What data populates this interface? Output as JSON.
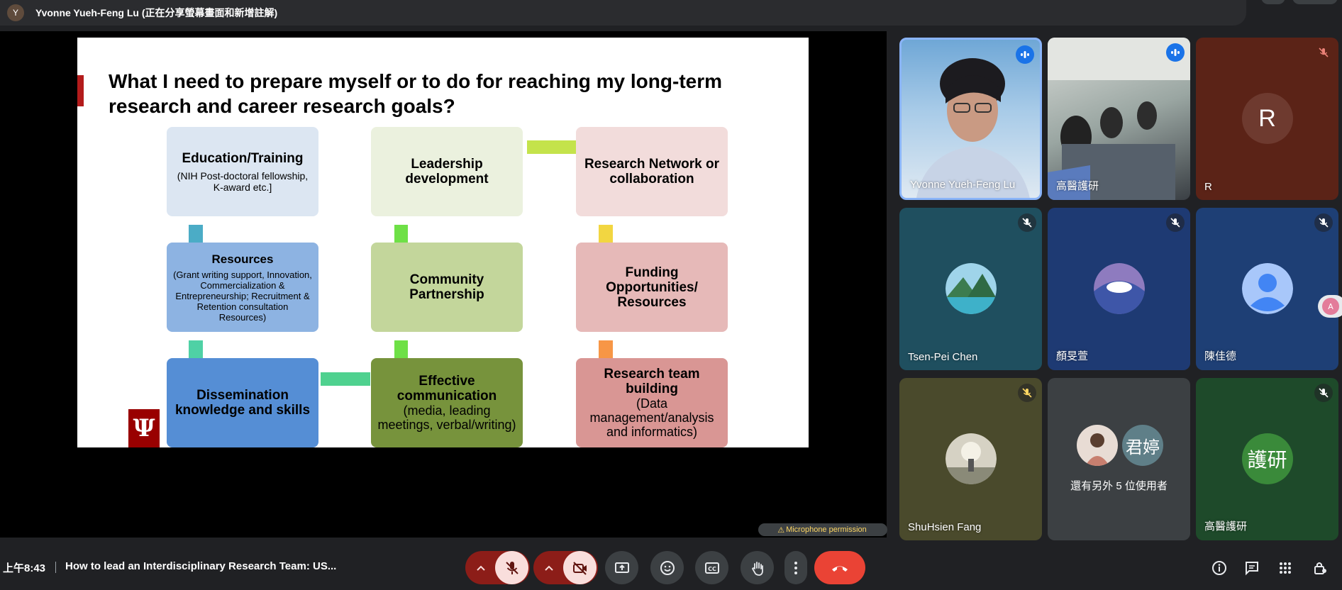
{
  "topbar": {
    "avatar_letter": "Y",
    "presenter_text": "Yvonne Yueh-Feng Lu (正在分享螢幕畫面和新增註解)"
  },
  "slide": {
    "title": "What I need to prepare myself or to do for reaching my long-term research and career research goals?",
    "logo_text": "Ψ",
    "boxes": [
      {
        "title": "Education/Training",
        "sub": "(NIH Post-doctoral fellowship, K-award etc.]",
        "color": "#dce6f2"
      },
      {
        "title": "Leadership development",
        "sub": "",
        "color": "#ebf1de"
      },
      {
        "title": "Research Network or collaboration",
        "sub": "",
        "color": "#f2dcdb"
      },
      {
        "title": "Resources",
        "sub": "(Grant writing support, Innovation, Commercialization & Entrepreneurship; Recruitment & Retention consultation Resources)",
        "color": "#8db3e2"
      },
      {
        "title": "Community Partnership",
        "sub": "",
        "color": "#c3d69b"
      },
      {
        "title": "Funding Opportunities/ Resources",
        "sub": "",
        "color": "#e6b9b8"
      },
      {
        "title": "Dissemination knowledge and skills",
        "sub": "",
        "color": "#558ed5"
      },
      {
        "title": "Effective communication",
        "sub": "(media, leading meetings, verbal/writing)",
        "color": "#77933c"
      },
      {
        "title": "Research team building",
        "sub": "(Data management/analysis and informatics)",
        "color": "#d99694"
      }
    ],
    "connector_colors": {
      "teal": "#4bacc6",
      "mint": "#4fd1a5",
      "green": "#6ee046",
      "lime": "#c4e34b",
      "yellow": "#f2d641",
      "orange": "#f79646",
      "seafoam": "#4fd18f"
    }
  },
  "mic_permission": {
    "icon": "⚠",
    "text": "Microphone permission"
  },
  "participants": [
    {
      "name": "Yvonne Yueh-Feng Lu",
      "type": "video",
      "badge": "speaking-icon"
    },
    {
      "name": "高醫護研",
      "type": "video",
      "badge": "speaking-icon"
    },
    {
      "name": "R",
      "initial": "R",
      "type": "initial",
      "badge": "mic-off-icon"
    },
    {
      "name": "Tsen-Pei Chen",
      "type": "photo",
      "badge": "mic-off-icon"
    },
    {
      "name": "顏旻萱",
      "type": "photo",
      "badge": "mic-off-icon"
    },
    {
      "name": "陳佳德",
      "type": "default-avatar",
      "badge": "mic-off-icon"
    },
    {
      "name": "ShuHsien Fang",
      "type": "photo",
      "badge": "mic-off-icon"
    },
    {
      "name": "",
      "type": "overflow",
      "initial": "君婷",
      "overflow_text": "還有另外 5 位使用者"
    },
    {
      "name": "高醫護研",
      "initial": "護研",
      "type": "initial",
      "badge": "mic-off-icon"
    }
  ],
  "bottombar": {
    "time": "上午8:43",
    "meeting_title": "How to lead an Interdisciplinary Research Team: US...",
    "controls": [
      "microphone-off",
      "camera-off",
      "present-screen",
      "reactions",
      "captions",
      "raise-hand",
      "more-options",
      "leave-call"
    ],
    "right_icons": [
      "meeting-details",
      "chat",
      "activities",
      "host-controls"
    ]
  }
}
